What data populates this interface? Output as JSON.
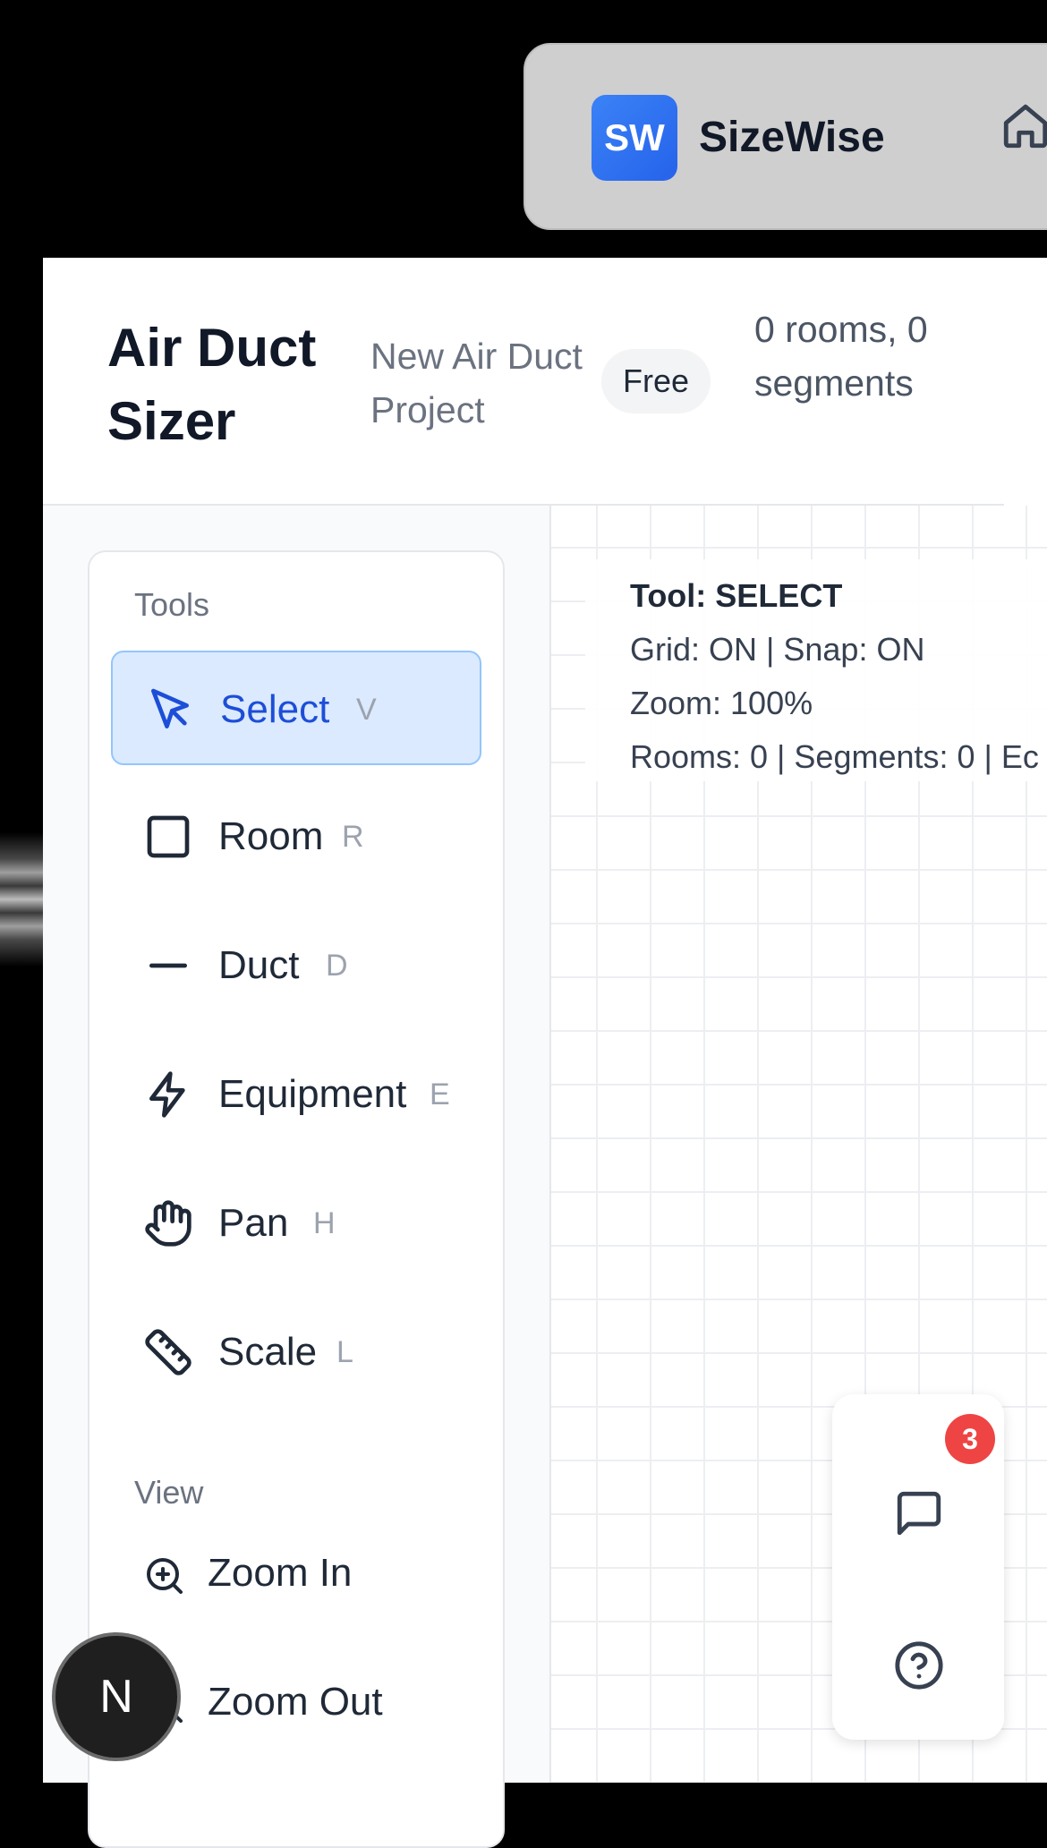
{
  "nav": {
    "logo_abbr": "SW",
    "brand": "SizeWise"
  },
  "header": {
    "title": "Air Duct Sizer",
    "project": "New Air Duct Project",
    "plan": "Free",
    "stats": "0 rooms, 0 segments"
  },
  "sidebar": {
    "tools_label": "Tools",
    "tools": [
      {
        "label": "Select",
        "key": "V",
        "icon": "cursor-icon",
        "active": true
      },
      {
        "label": "Room",
        "key": "R",
        "icon": "square-icon"
      },
      {
        "label": "Duct",
        "key": "D",
        "icon": "line-icon"
      },
      {
        "label": "Equipment",
        "key": "E",
        "icon": "lightning-icon"
      },
      {
        "label": "Pan",
        "key": "H",
        "icon": "hand-icon"
      },
      {
        "label": "Scale",
        "key": "L",
        "icon": "ruler-icon"
      }
    ],
    "view_label": "View",
    "view": [
      {
        "label": "Zoom In",
        "icon": "zoom-in-icon"
      },
      {
        "label": "Zoom Out",
        "icon": "zoom-out-icon"
      }
    ]
  },
  "canvas": {
    "status": {
      "tool": "Tool: SELECT",
      "grid": "Grid: ON | Snap: ON",
      "zoom": "Zoom: 100%",
      "counts": "Rooms: 0 | Segments: 0 | Ec"
    }
  },
  "fab": {
    "badge": "3",
    "chat_icon": "chat-icon",
    "help_icon": "help-icon"
  },
  "avatar": "N",
  "colors": {
    "accent": "#2563eb",
    "active_bg": "#dbeafe",
    "badge_red": "#ef4444"
  }
}
